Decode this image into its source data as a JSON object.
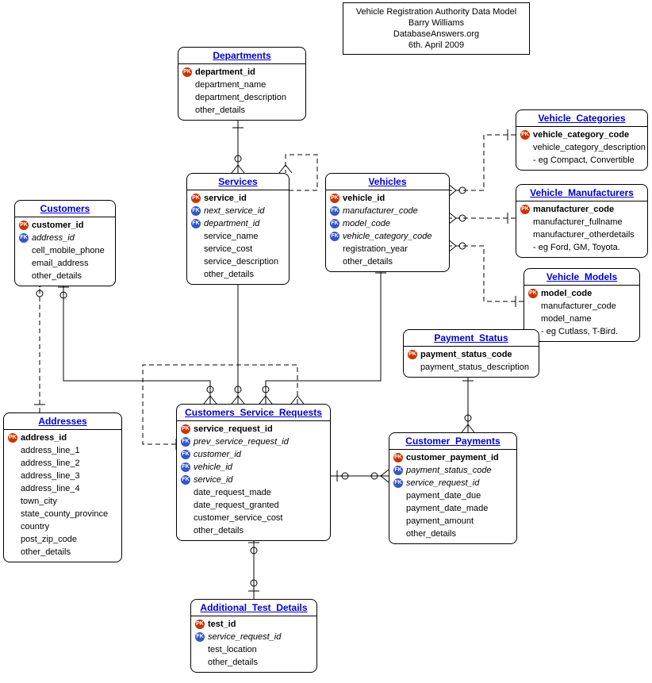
{
  "title_box": {
    "line1": "Vehicle Registration Authority Data Model",
    "line2": "Barry Williams",
    "line3": "DatabaseAnswers.org",
    "line4": "6th. April 2009"
  },
  "entities": {
    "departments": {
      "title": "Departments",
      "attrs": [
        {
          "key": "PK",
          "name": "department_id",
          "bold": true
        },
        {
          "key": "",
          "name": "department_name"
        },
        {
          "key": "",
          "name": "department_description"
        },
        {
          "key": "",
          "name": "other_details"
        }
      ]
    },
    "services": {
      "title": "Services",
      "attrs": [
        {
          "key": "PK",
          "name": "service_id",
          "bold": true
        },
        {
          "key": "FK",
          "name": "next_service_id",
          "italic": true
        },
        {
          "key": "FK",
          "name": "department_id",
          "italic": true
        },
        {
          "key": "",
          "name": "service_name"
        },
        {
          "key": "",
          "name": "service_cost"
        },
        {
          "key": "",
          "name": "service_description"
        },
        {
          "key": "",
          "name": "other_details"
        }
      ]
    },
    "vehicles": {
      "title": "Vehicles",
      "attrs": [
        {
          "key": "PK",
          "name": "vehicle_id",
          "bold": true
        },
        {
          "key": "FK",
          "name": "manufacturer_code",
          "italic": true
        },
        {
          "key": "FK",
          "name": "model_code",
          "italic": true
        },
        {
          "key": "FK",
          "name": "vehicle_category_code",
          "italic": true
        },
        {
          "key": "",
          "name": "registration_year"
        },
        {
          "key": "",
          "name": "other_details"
        }
      ]
    },
    "vehicle_categories": {
      "title": "Vehicle_Categories",
      "attrs": [
        {
          "key": "PK",
          "name": "vehicle_category_code",
          "bold": true
        },
        {
          "key": "",
          "name": "vehicle_category_description"
        },
        {
          "key": "",
          "name": "- eg Compact, Convertible"
        }
      ]
    },
    "vehicle_manufacturers": {
      "title": "Vehicle_Manufacturers",
      "attrs": [
        {
          "key": "PK",
          "name": "manufacturer_code",
          "bold": true
        },
        {
          "key": "",
          "name": "manufacturer_fullname"
        },
        {
          "key": "",
          "name": "manufacturer_otherdetails"
        },
        {
          "key": "",
          "name": "- eg Ford, GM, Toyota."
        }
      ]
    },
    "vehicle_models": {
      "title": "Vehicle_Models",
      "attrs": [
        {
          "key": "PK",
          "name": "model_code",
          "bold": true
        },
        {
          "key": "",
          "name": "manufacturer_code"
        },
        {
          "key": "",
          "name": "model_name"
        },
        {
          "key": "",
          "name": "- eg Cutlass, T-Bird."
        }
      ]
    },
    "customers": {
      "title": "Customers",
      "attrs": [
        {
          "key": "PK",
          "name": "customer_id",
          "bold": true
        },
        {
          "key": "FK",
          "name": "address_id",
          "italic": true
        },
        {
          "key": "",
          "name": "cell_mobile_phone"
        },
        {
          "key": "",
          "name": "email_address"
        },
        {
          "key": "",
          "name": "other_details"
        }
      ]
    },
    "addresses": {
      "title": "Addresses",
      "attrs": [
        {
          "key": "PK",
          "name": "address_id",
          "bold": true
        },
        {
          "key": "",
          "name": "address_line_1"
        },
        {
          "key": "",
          "name": "address_line_2"
        },
        {
          "key": "",
          "name": "address_line_3"
        },
        {
          "key": "",
          "name": "address_line_4"
        },
        {
          "key": "",
          "name": "town_city"
        },
        {
          "key": "",
          "name": "state_county_province"
        },
        {
          "key": "",
          "name": "country"
        },
        {
          "key": "",
          "name": "post_zip_code"
        },
        {
          "key": "",
          "name": "other_details"
        }
      ]
    },
    "payment_status": {
      "title": "Payment_Status",
      "attrs": [
        {
          "key": "PK",
          "name": "payment_status_code",
          "bold": true
        },
        {
          "key": "",
          "name": "payment_status_description"
        }
      ]
    },
    "csr": {
      "title": "Customers_Service_Requests",
      "attrs": [
        {
          "key": "PK",
          "name": "service_request_id",
          "bold": true
        },
        {
          "key": "FK",
          "name": "prev_service_request_id",
          "italic": true
        },
        {
          "key": "FK",
          "name": "customer_id",
          "italic": true
        },
        {
          "key": "FK",
          "name": "vehicle_id",
          "italic": true
        },
        {
          "key": "FK",
          "name": "service_id",
          "italic": true
        },
        {
          "key": "",
          "name": "date_request_made"
        },
        {
          "key": "",
          "name": "date_request_granted"
        },
        {
          "key": "",
          "name": "customer_service_cost"
        },
        {
          "key": "",
          "name": "other_details"
        }
      ]
    },
    "customer_payments": {
      "title": "Customer_Payments",
      "attrs": [
        {
          "key": "PK",
          "name": "customer_payment_id",
          "bold": true
        },
        {
          "key": "FK",
          "name": "payment_status_code",
          "italic": true
        },
        {
          "key": "FK",
          "name": "service_request_id",
          "italic": true
        },
        {
          "key": "",
          "name": "payment_date_due"
        },
        {
          "key": "",
          "name": "payment_date_made"
        },
        {
          "key": "",
          "name": "payment_amount"
        },
        {
          "key": "",
          "name": "other_details"
        }
      ]
    },
    "additional_test_details": {
      "title": "Additional_Test_Details",
      "attrs": [
        {
          "key": "PK",
          "name": "test_id",
          "bold": true
        },
        {
          "key": "FK",
          "name": "service_request_id",
          "italic": true
        },
        {
          "key": "",
          "name": "test_location"
        },
        {
          "key": "",
          "name": "other_details"
        }
      ]
    }
  },
  "relationships": [
    {
      "from": "Departments",
      "to": "Services",
      "type": "one-to-many"
    },
    {
      "from": "Services",
      "to": "Services",
      "type": "self-ref"
    },
    {
      "from": "Services",
      "to": "Customers_Service_Requests",
      "type": "one-to-many"
    },
    {
      "from": "Vehicles",
      "to": "Customers_Service_Requests",
      "type": "one-to-many"
    },
    {
      "from": "Vehicle_Categories",
      "to": "Vehicles",
      "type": "one-to-many",
      "style": "dashed"
    },
    {
      "from": "Vehicle_Manufacturers",
      "to": "Vehicles",
      "type": "one-to-many",
      "style": "dashed"
    },
    {
      "from": "Vehicle_Models",
      "to": "Vehicles",
      "type": "one-to-many",
      "style": "dashed"
    },
    {
      "from": "Customers",
      "to": "Customers_Service_Requests",
      "type": "one-to-many"
    },
    {
      "from": "Addresses",
      "to": "Customers",
      "type": "one-to-many",
      "style": "dashed"
    },
    {
      "from": "Payment_Status",
      "to": "Customer_Payments",
      "type": "one-to-many"
    },
    {
      "from": "Customers_Service_Requests",
      "to": "Customer_Payments",
      "type": "one-to-many"
    },
    {
      "from": "Customers_Service_Requests",
      "to": "Additional_Test_Details",
      "type": "one-to-many"
    },
    {
      "from": "Customers_Service_Requests",
      "to": "Customers_Service_Requests",
      "type": "self-ref",
      "style": "dashed"
    }
  ]
}
